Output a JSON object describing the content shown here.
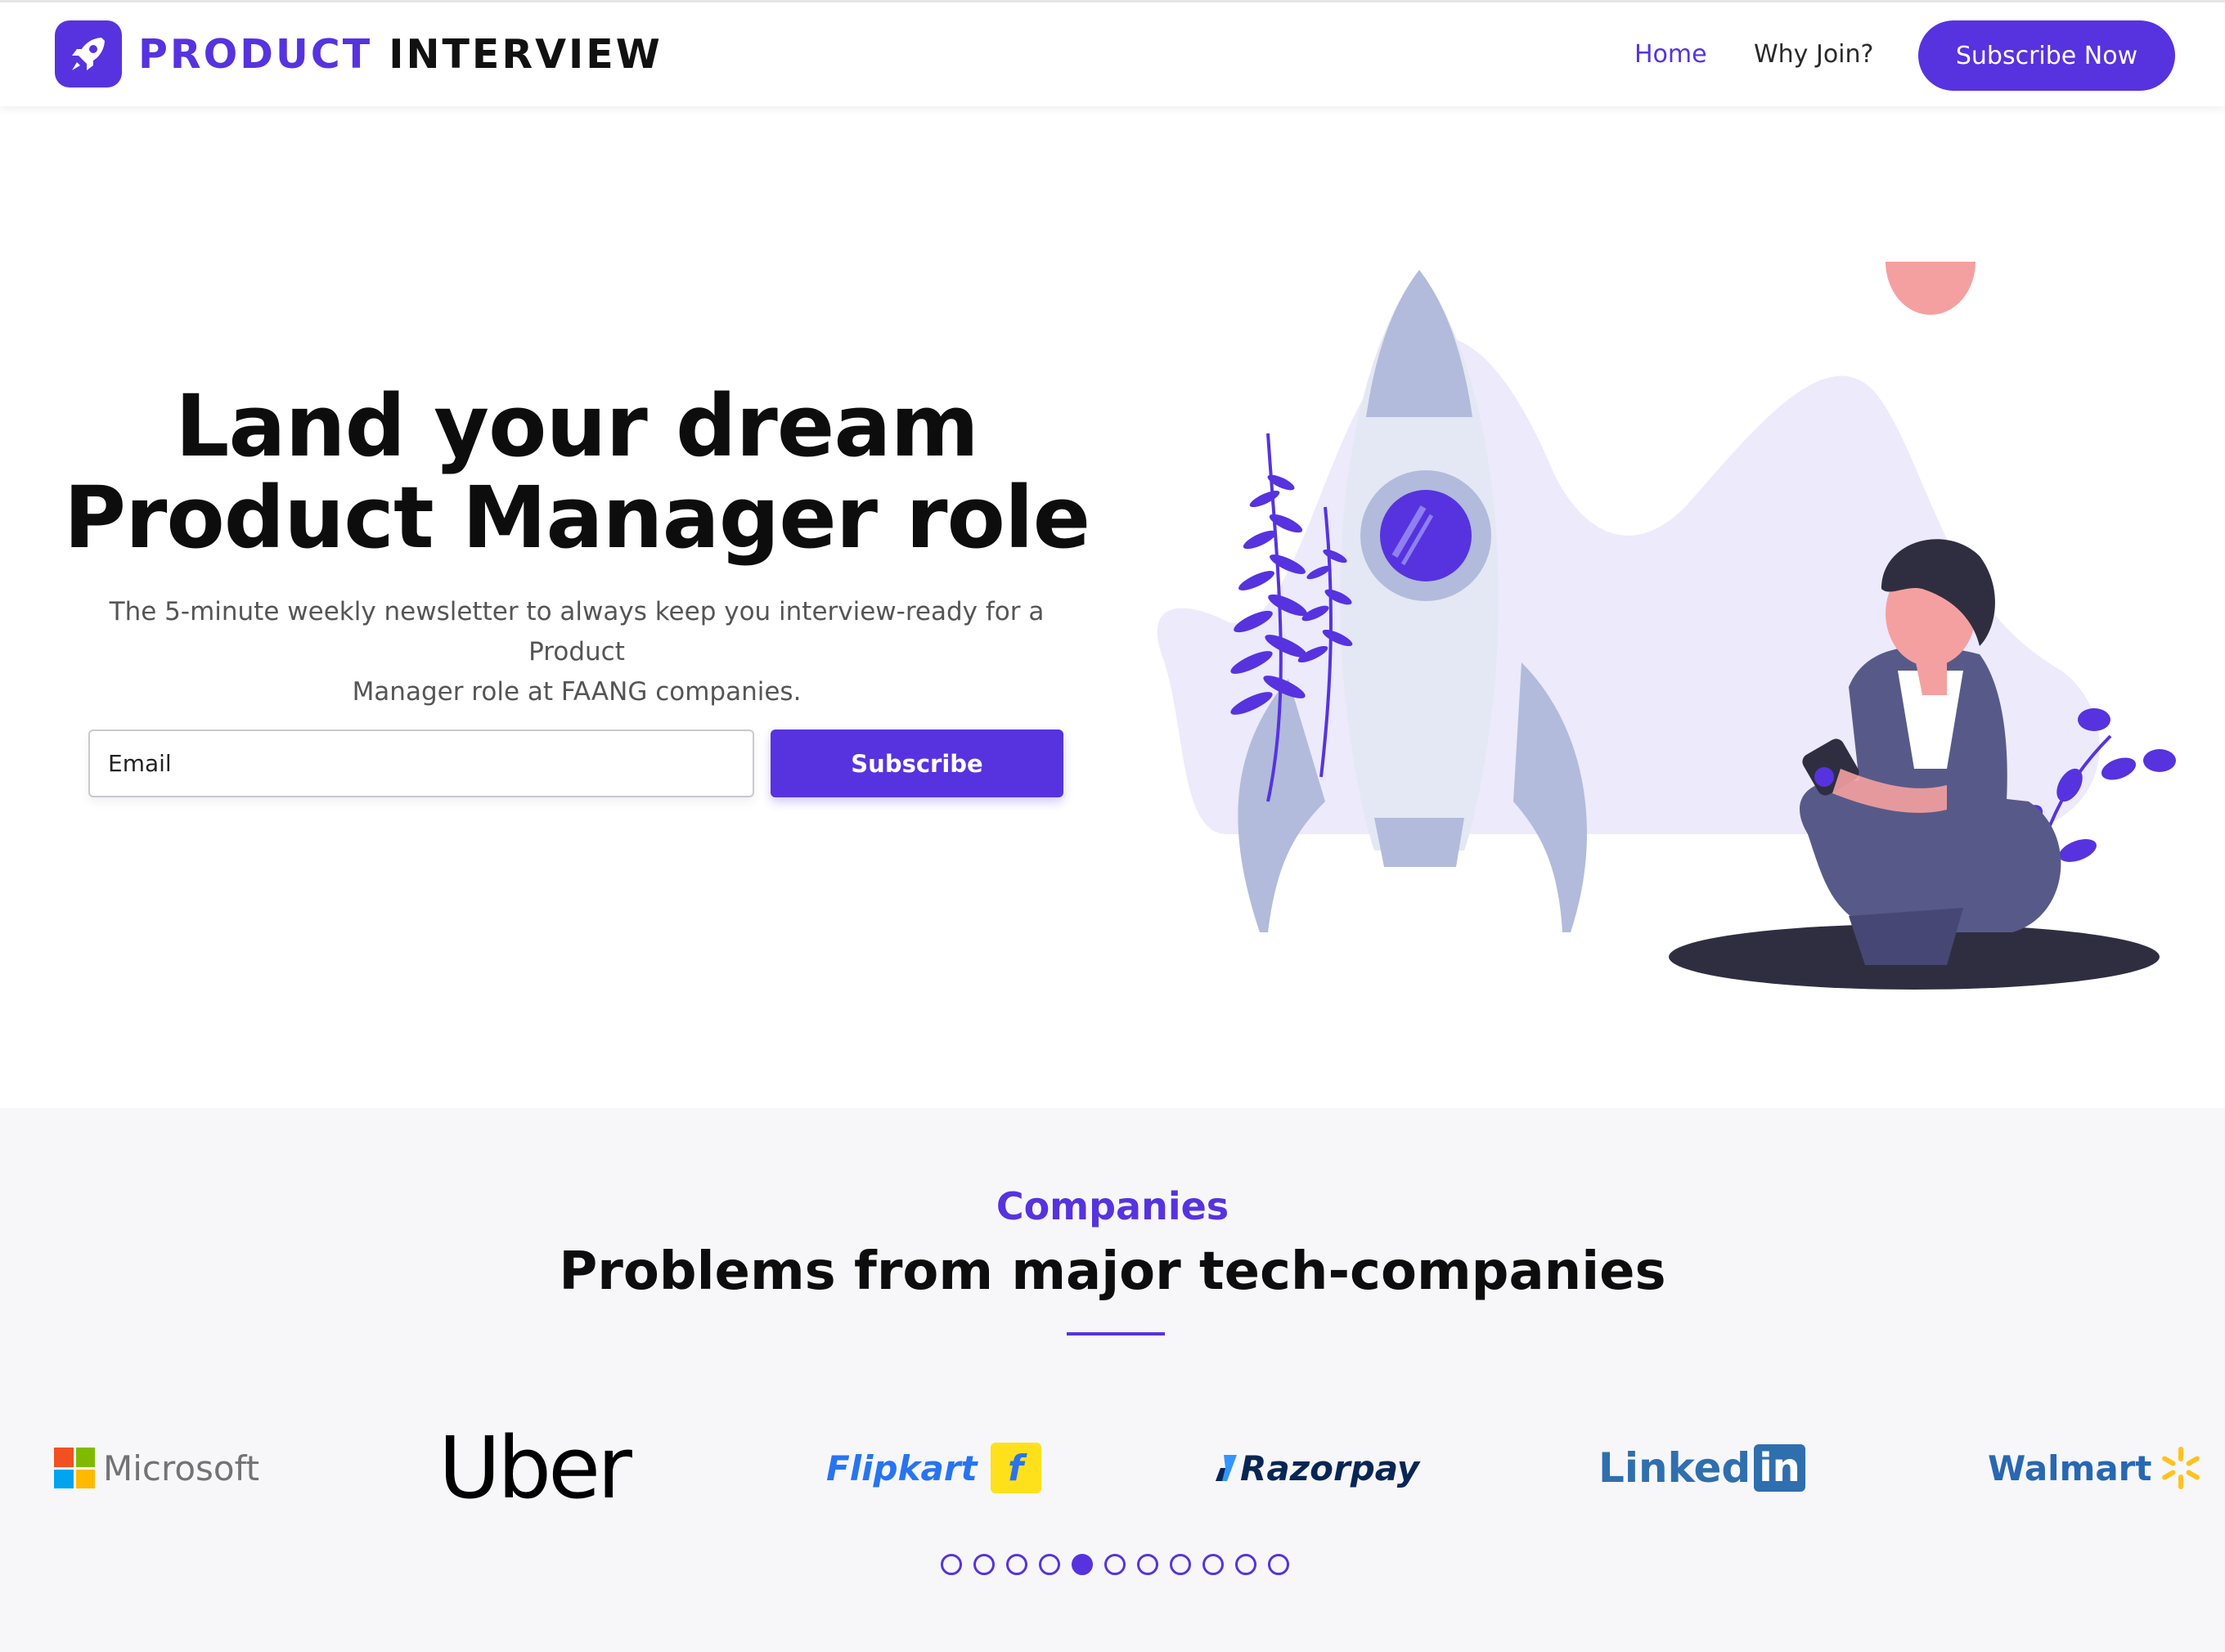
{
  "header": {
    "brand_part1": "PRODUCT",
    "brand_part2": "INTERVIEW",
    "logo_icon": "rocket-icon",
    "nav": [
      {
        "label": "Home",
        "active": true
      },
      {
        "label": "Why Join?",
        "active": false
      }
    ],
    "cta_label": "Subscribe Now"
  },
  "hero": {
    "title_line1": "Land your dream",
    "title_line2": "Product Manager role",
    "subtitle_line1": "The 5-minute weekly newsletter to always keep you interview-ready for a Product",
    "subtitle_line2": "Manager role at FAANG companies.",
    "email_placeholder": "Email",
    "subscribe_label": "Subscribe"
  },
  "companies": {
    "label": "Companies",
    "title": "Problems from major tech-companies",
    "logos": [
      "Microsoft",
      "Uber",
      "Flipkart",
      "Razorpay",
      "Linked",
      "Walmart"
    ],
    "linkedin_suffix": "in",
    "carousel": {
      "count": 11,
      "active_index": 4
    }
  },
  "colors": {
    "accent": "#5633df",
    "section_bg": "#f7f7f9"
  }
}
